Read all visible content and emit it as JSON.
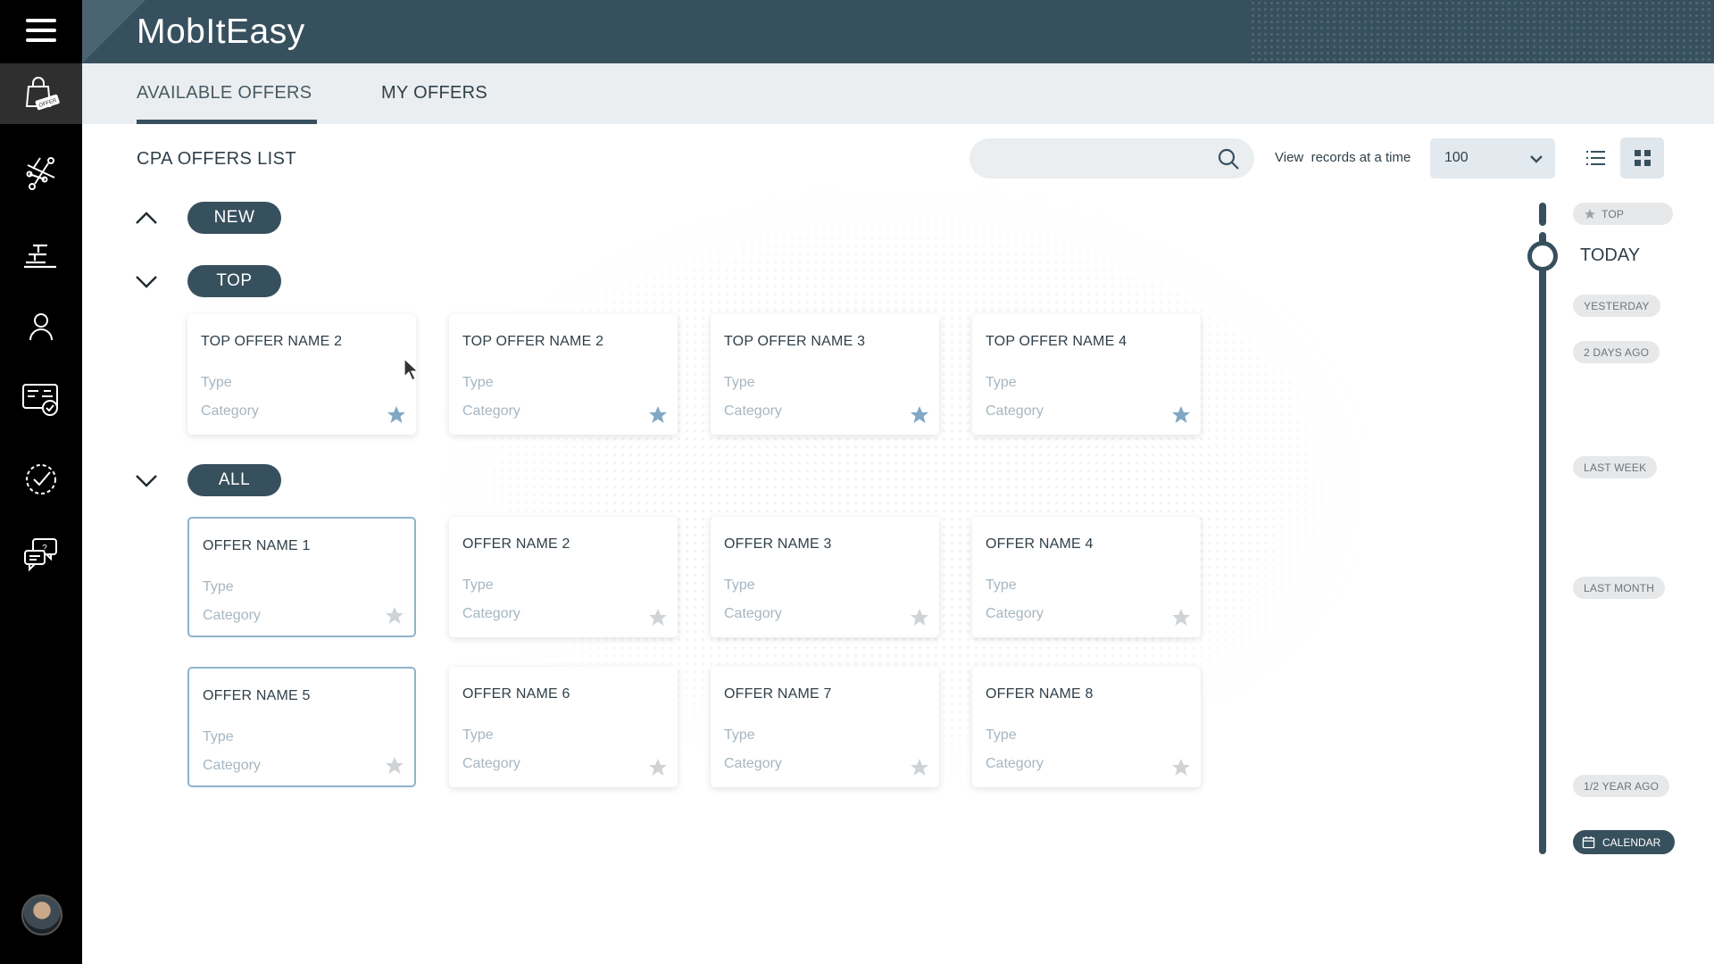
{
  "app": {
    "title": "MobItEasy"
  },
  "sidebar": {
    "items": [
      {
        "name": "offers",
        "icon": "shopping-bag-offer-icon",
        "badge": "OFFER"
      },
      {
        "name": "network",
        "icon": "network-icon"
      },
      {
        "name": "reports",
        "icon": "reports-icon"
      },
      {
        "name": "profile",
        "icon": "user-icon"
      },
      {
        "name": "billing",
        "icon": "payment-card-icon"
      },
      {
        "name": "approvals",
        "icon": "check-circle-icon"
      },
      {
        "name": "support",
        "icon": "chat-help-icon"
      }
    ]
  },
  "tabs": [
    {
      "label": "AVAILABLE OFFERS",
      "active": true
    },
    {
      "label": "MY OFFERS",
      "active": false
    }
  ],
  "main": {
    "list_title": "CPA OFFERS LIST",
    "search": {
      "placeholder": "",
      "value": ""
    },
    "view_label": "View  records at a time",
    "records_per_page": "100"
  },
  "sections": {
    "new": {
      "label": "NEW"
    },
    "top": {
      "label": "TOP",
      "cards": [
        {
          "name": "TOP OFFER NAME 2",
          "type": "Type",
          "category": "Category"
        },
        {
          "name": "TOP OFFER NAME 2",
          "type": "Type",
          "category": "Category"
        },
        {
          "name": "TOP OFFER NAME 3",
          "type": "Type",
          "category": "Category"
        },
        {
          "name": "TOP OFFER NAME 4",
          "type": "Type",
          "category": "Category"
        }
      ]
    },
    "all": {
      "label": "ALL",
      "cards": [
        {
          "name": "OFFER NAME 1",
          "type": "Type",
          "category": "Category"
        },
        {
          "name": "OFFER NAME 2",
          "type": "Type",
          "category": "Category"
        },
        {
          "name": "OFFER NAME 3",
          "type": "Type",
          "category": "Category"
        },
        {
          "name": "OFFER NAME 4",
          "type": "Type",
          "category": "Category"
        },
        {
          "name": "OFFER NAME 5",
          "type": "Type",
          "category": "Category"
        },
        {
          "name": "OFFER NAME 6",
          "type": "Type",
          "category": "Category"
        },
        {
          "name": "OFFER NAME 7",
          "type": "Type",
          "category": "Category"
        },
        {
          "name": "OFFER NAME 8",
          "type": "Type",
          "category": "Category"
        }
      ]
    }
  },
  "timeline": {
    "top": "TOP",
    "today": "TODAY",
    "yesterday": "YESTERDAY",
    "two_days": "2 DAYS AGO",
    "last_week": "LAST WEEK",
    "last_month": "LAST MONTH",
    "half_year": "1/2 YEAR AGO",
    "calendar": "CALENDAR"
  },
  "colors": {
    "header": "#37505e",
    "sidebar": "#000000",
    "star_active": "#7fa8c6",
    "star_inactive": "#cfd3d6",
    "selected_border": "#8fb3cc"
  }
}
